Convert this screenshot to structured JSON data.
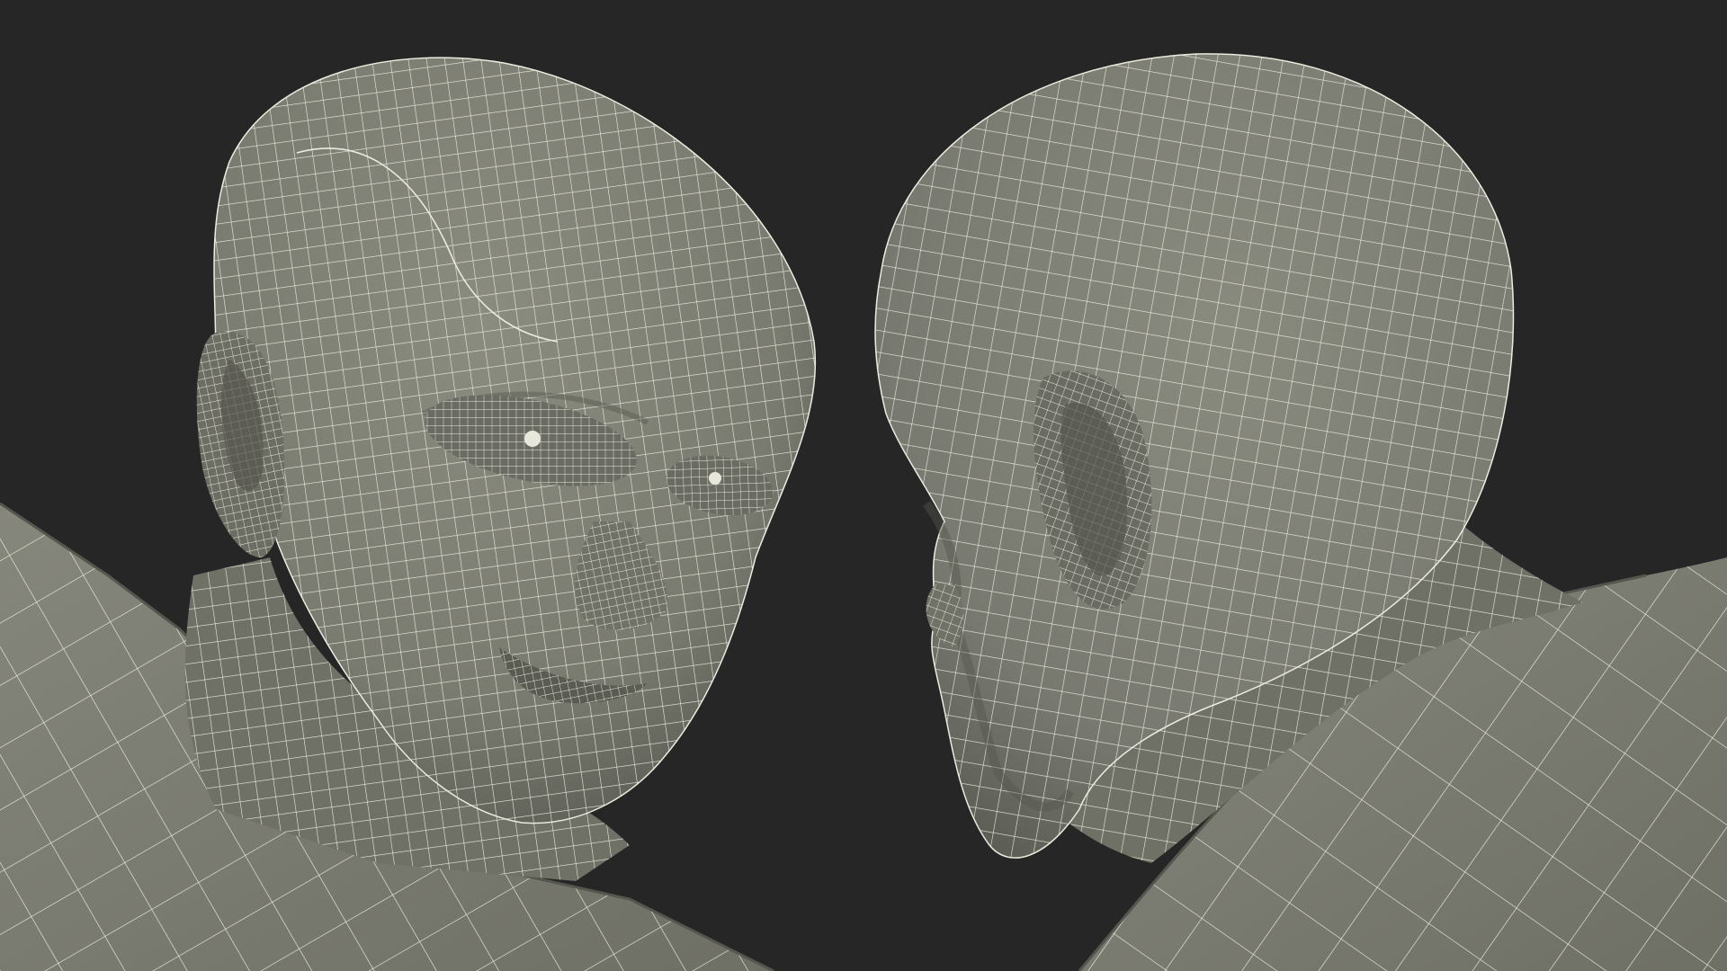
{
  "scene": {
    "background_color": "#262626",
    "mesh_fill_color": "#7c7d72",
    "mesh_shadow_color": "#55564e",
    "mesh_highlight_color": "#9a9b8f",
    "wire_color": "#ecebdf",
    "objects": [
      {
        "id": "left-head",
        "label": "",
        "view": "three-quarter-front"
      },
      {
        "id": "right-head",
        "label": "",
        "view": "side-profile"
      }
    ]
  }
}
